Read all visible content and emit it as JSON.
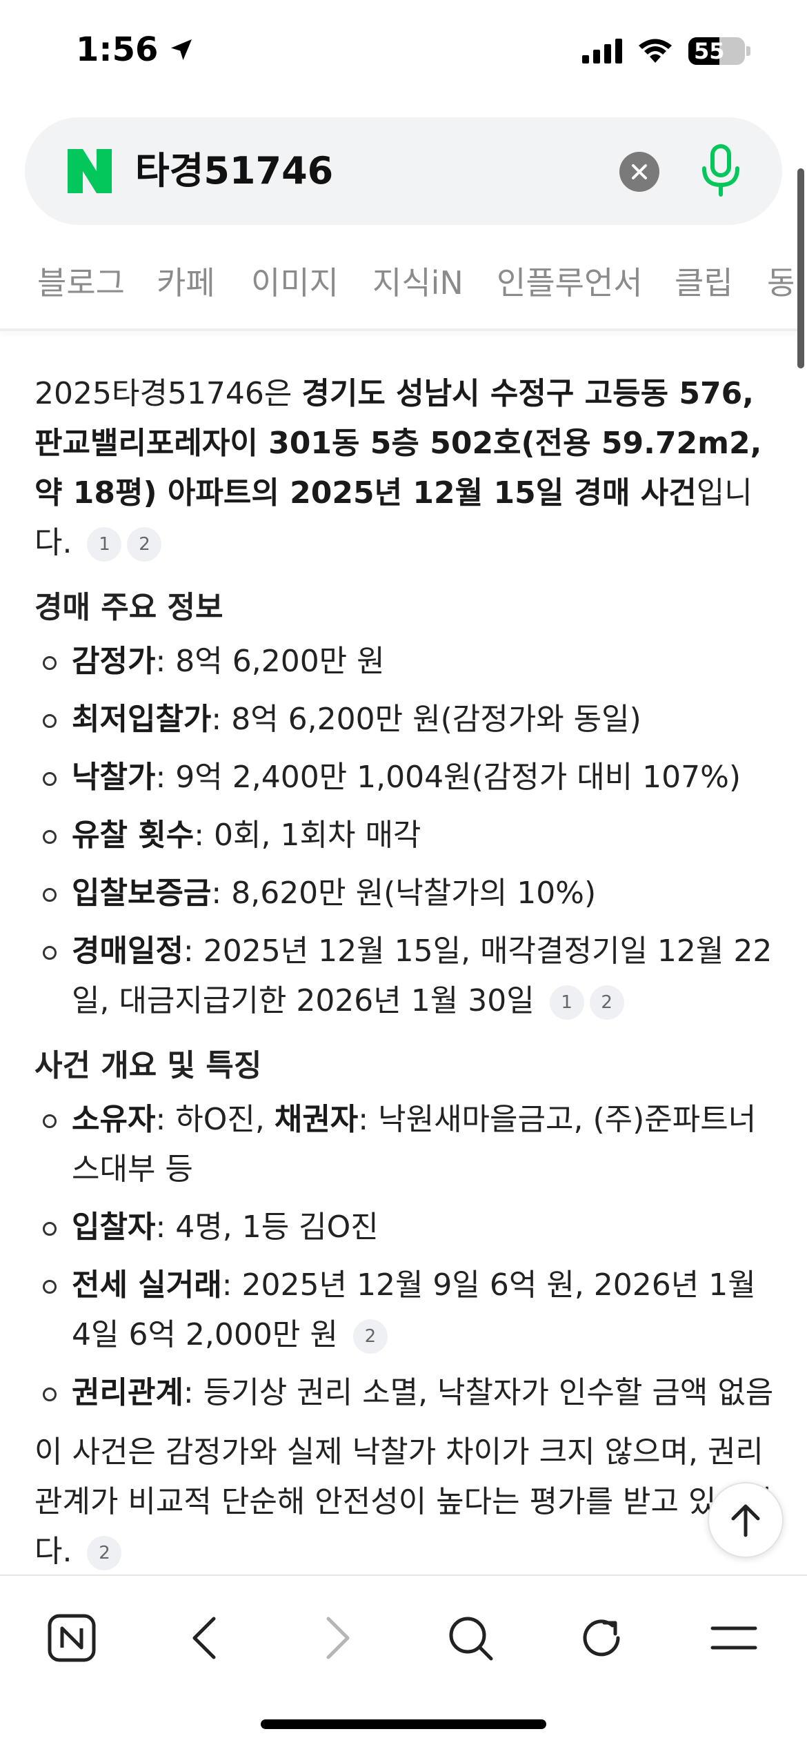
{
  "status_bar": {
    "time": "1:56",
    "battery_level": "55",
    "battery_percent": 55
  },
  "search": {
    "query": "타경51746",
    "logo_letter": "N",
    "brand_color": "#03c75a"
  },
  "tabs": [
    {
      "label": "블로그"
    },
    {
      "label": "카페"
    },
    {
      "label": "이미지"
    },
    {
      "label": "지식iN"
    },
    {
      "label": "인플루언서"
    },
    {
      "label": "클립"
    },
    {
      "label": "동영상"
    }
  ],
  "summary": {
    "lead": "2025타경51746은 ",
    "bold": "경기도 성남시 수정구 고등동 576, 판교밸리포레자이 301동 5층 502호(전용 59.72m2, 약 18평) 아파트의 2025년 12월 15일 경매 사건",
    "tail": "입니다.",
    "cites": [
      "1",
      "2"
    ]
  },
  "section1": {
    "title": "경매 주요 정보",
    "items": [
      {
        "label": "감정가",
        "text": ": 8억 6,200만 원"
      },
      {
        "label": "최저입찰가",
        "text": ": 8억 6,200만 원(감정가와 동일)"
      },
      {
        "label": "낙찰가",
        "text": ": 9억 2,400만 1,004원(감정가 대비 107%)"
      },
      {
        "label": "유찰 횟수",
        "text": ": 0회, 1회차 매각"
      },
      {
        "label": "입찰보증금",
        "text": ": 8,620만 원(낙찰가의 10%)"
      },
      {
        "label": "경매일정",
        "text": ": 2025년 12월 15일, 매각결정기일 12월 22일, 대금지급기한 2026년 1월 30일",
        "cites": [
          "1",
          "2"
        ]
      }
    ]
  },
  "section2": {
    "title": "사건 개요 및 특징",
    "owner_label": "소유자",
    "owner_text": ": 하O진, ",
    "creditor_label": "채권자",
    "creditor_text": ": 낙원새마을금고, (주)준파트너스대부 등",
    "bidder_label": "입찰자",
    "bidder_text": ": 4명, 1등 김O진",
    "rent_label": "전세 실거래",
    "rent_text": ": 2025년 12월 9일 6억 원, 2026년 1월 4일 6억 2,000만 원",
    "rent_cite": "2",
    "rights_label": "권리관계",
    "rights_text": ": 등기상 권리 소멸, 낙찰자가 인수할 금액 없음"
  },
  "closing": {
    "text": "이 사건은 감정가와 실제 낙찰가 차이가 크지 않으며, 권리관계가 비교적 단순해 안전성이 높다는 평가를 받고 있습니다.",
    "cite": "2"
  },
  "bottom_nav": {
    "home_letter": "N"
  }
}
